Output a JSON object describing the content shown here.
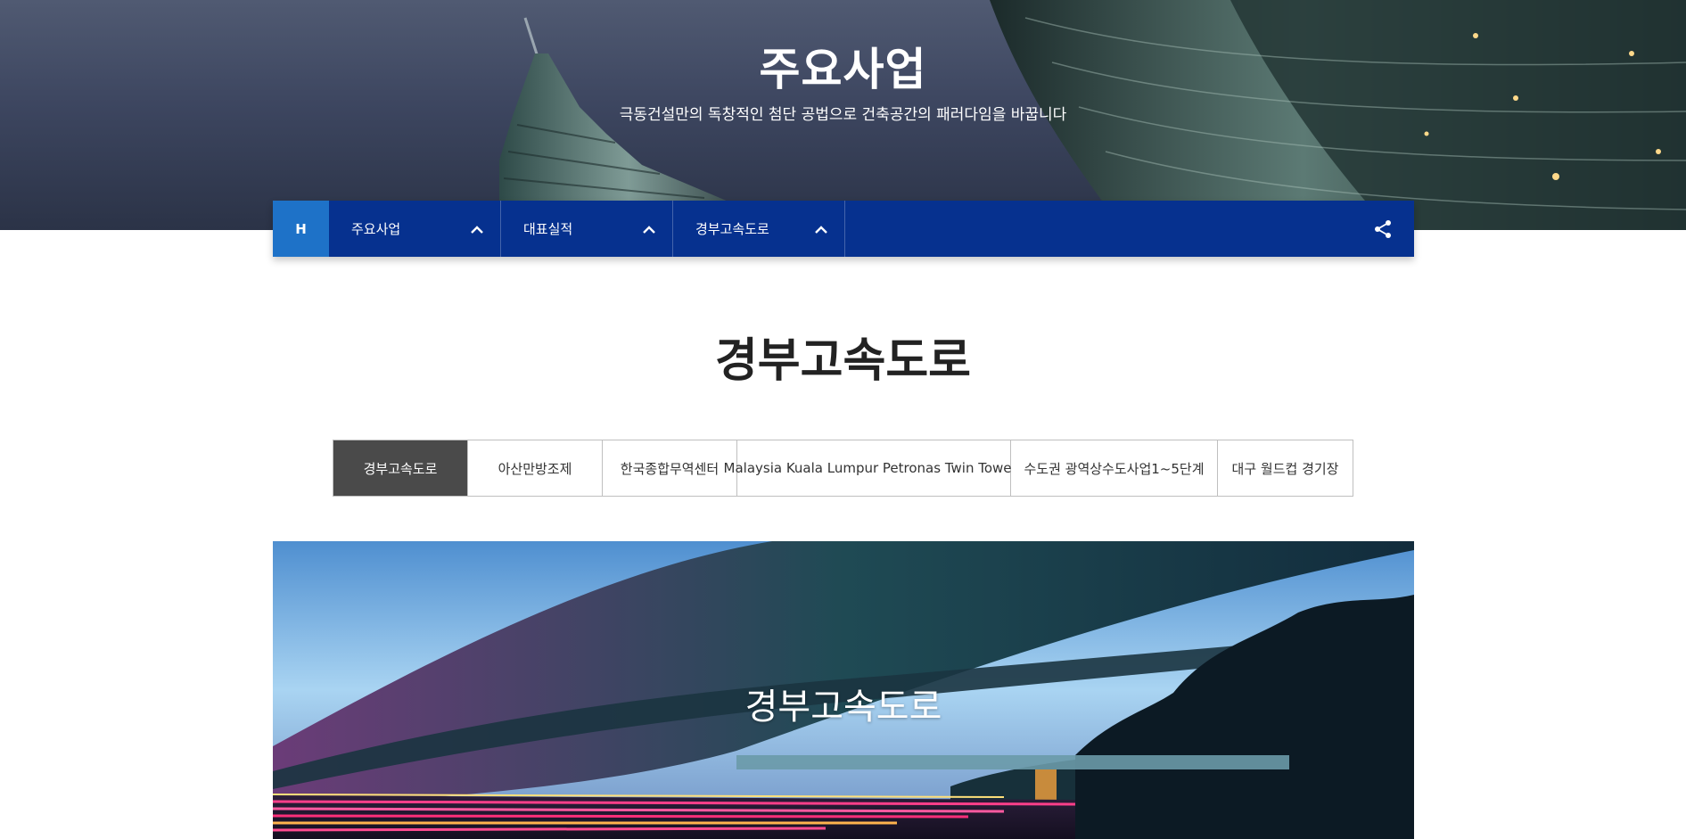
{
  "hero": {
    "title": "주요사업",
    "subtitle": "극동건설만의 독창적인 첨단 공법으로 건축공간의 패러다임을 바꿉니다"
  },
  "nav": {
    "home_label": "H",
    "items": [
      {
        "label": "주요사업",
        "icon": "chevron-up-icon"
      },
      {
        "label": "대표실적",
        "icon": "chevron-up-icon"
      },
      {
        "label": "경부고속도로",
        "icon": "chevron-up-icon"
      }
    ],
    "share_icon": "share-icon",
    "colors": {
      "bar": "#06318f",
      "home": "#1e72c8"
    }
  },
  "page": {
    "title": "경부고속도로"
  },
  "tabs": [
    {
      "label": "경부고속도로",
      "active": true
    },
    {
      "label": "아산만방조제",
      "active": false
    },
    {
      "label": "한국종합무역센터",
      "active": false
    },
    {
      "label": "Malaysia Kuala Lumpur Petronas Twin Towers",
      "active": false
    },
    {
      "label": "수도권 광역상수도사업1~5단계",
      "active": false
    },
    {
      "label": "대구 월드컵 경기장",
      "active": false
    }
  ],
  "feature": {
    "label": "경부고속도로"
  }
}
